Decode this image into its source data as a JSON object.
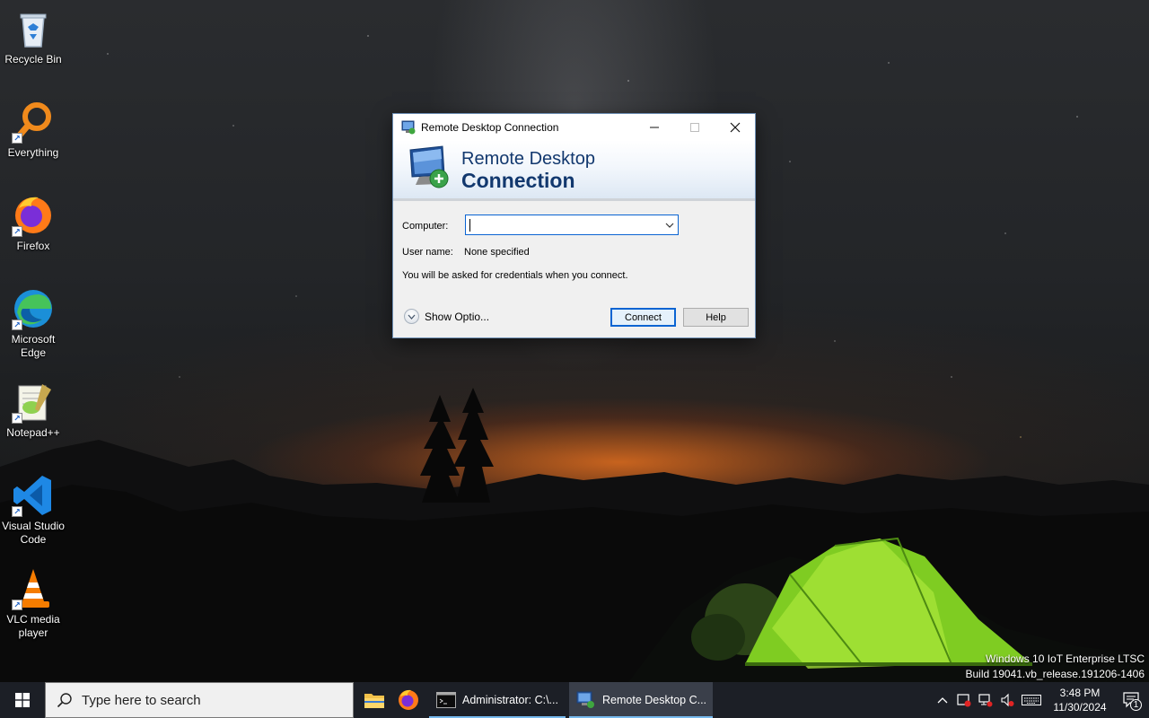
{
  "desktop": {
    "icons": [
      {
        "label": "Recycle Bin",
        "icon": "recycle-bin-icon"
      },
      {
        "label": "Everything",
        "icon": "everything-search-icon"
      },
      {
        "label": "Firefox",
        "icon": "firefox-icon"
      },
      {
        "label": "Microsoft Edge",
        "icon": "edge-icon"
      },
      {
        "label": "Notepad++",
        "icon": "notepadpp-icon"
      },
      {
        "label": "Visual Studio Code",
        "icon": "vscode-icon"
      },
      {
        "label": "VLC media player",
        "icon": "vlc-icon"
      }
    ],
    "watermark": {
      "line1": "Windows 10 IoT Enterprise LTSC",
      "line2": "Build 19041.vb_release.191206-1406"
    }
  },
  "rdc": {
    "title": "Remote Desktop Connection",
    "banner_line1": "Remote Desktop",
    "banner_line2": "Connection",
    "computer_label": "Computer:",
    "computer_value": "",
    "username_label": "User name:",
    "username_value": "None specified",
    "info_text": "You will be asked for credentials when you connect.",
    "show_options": "Show Optio...",
    "connect_label": "Connect",
    "help_label": "Help"
  },
  "taskbar": {
    "search_placeholder": "Type here to search",
    "windows": [
      {
        "label": "Administrator: C:\\...",
        "icon": "cmd-icon",
        "active": false
      },
      {
        "label": "Remote Desktop C...",
        "icon": "rdc-icon",
        "active": true
      }
    ],
    "clock": {
      "time": "3:48 PM",
      "date": "11/30/2024"
    },
    "notification_count": "1"
  },
  "colors": {
    "taskbar_bg": "#1c1f26",
    "rdc_banner_text": "#12386e",
    "accent": "#0a64d2",
    "active_underline": "#76b9ed"
  }
}
